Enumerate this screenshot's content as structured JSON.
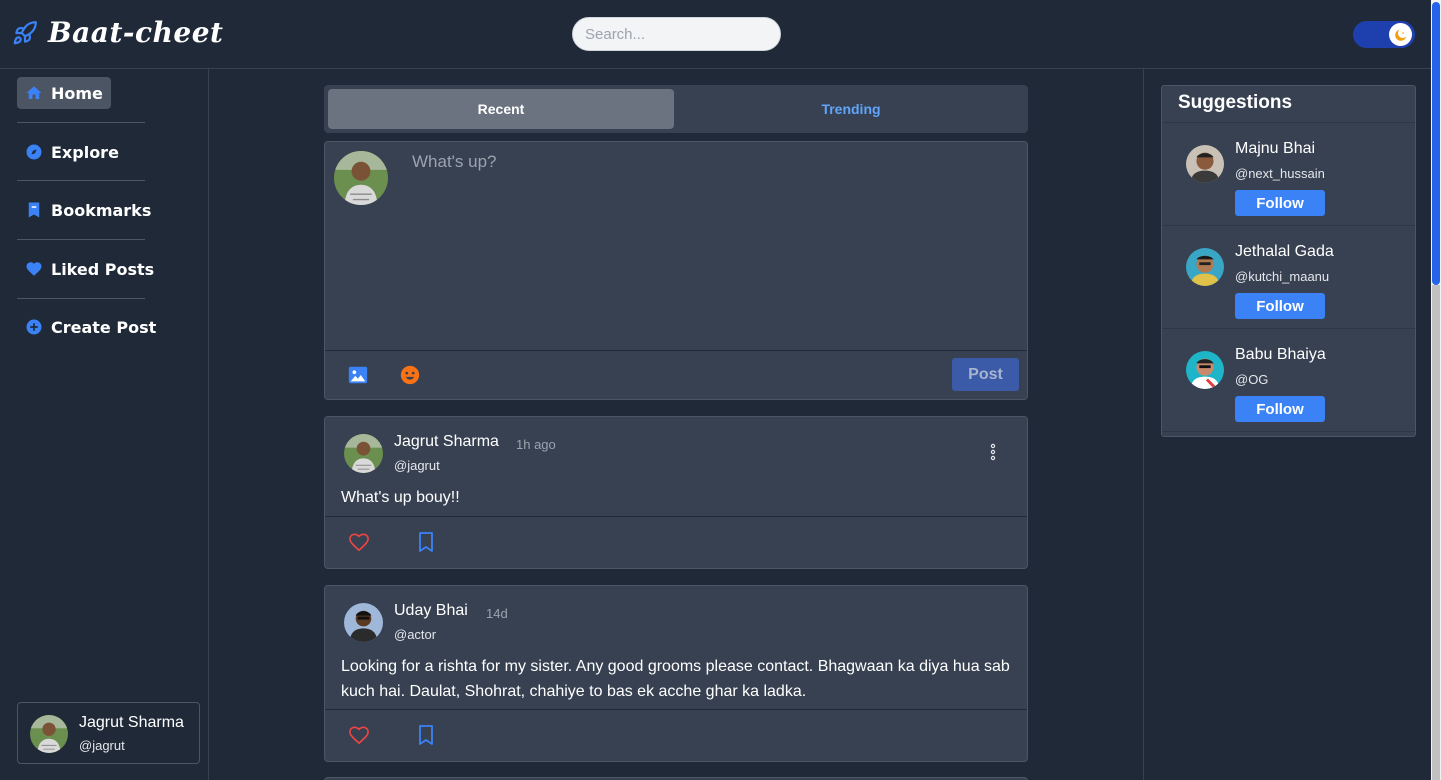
{
  "app": {
    "title": "Baat-cheet",
    "logo_icon": "rocket-icon"
  },
  "search": {
    "placeholder": "Search..."
  },
  "theme_toggle": {
    "icon": "moon-icon",
    "color": "#1e40af"
  },
  "sidebar": {
    "items": [
      {
        "label": "Home",
        "icon": "home-icon",
        "active": true
      },
      {
        "label": "Explore",
        "icon": "compass-icon"
      },
      {
        "label": "Bookmarks",
        "icon": "bookmark-icon"
      },
      {
        "label": "Liked Posts",
        "icon": "heart-icon"
      },
      {
        "label": "Create Post",
        "icon": "plus-circle-icon"
      }
    ],
    "profile": {
      "name": "Jagrut Sharma",
      "handle": "@jagrut"
    }
  },
  "feed": {
    "tabs": [
      {
        "label": "Recent",
        "active": true
      },
      {
        "label": "Trending"
      }
    ],
    "composer": {
      "placeholder": "What's up?",
      "post_label": "Post",
      "image_icon": "image-icon",
      "emoji_icon": "emoji-icon"
    },
    "posts": [
      {
        "author": "Jagrut Sharma",
        "time": "1h ago",
        "handle": "@jagrut",
        "body": "What's up bouy!!"
      },
      {
        "author": "Uday Bhai",
        "time": "14d",
        "handle": "@actor",
        "body": "Looking for a rishta for my sister. Any good grooms please contact. Bhagwaan ka diya hua sab kuch hai. Daulat, Shohrat, chahiye to bas ek acche ghar ka ladka."
      }
    ]
  },
  "suggestions": {
    "title": "Suggestions",
    "follow_label": "Follow",
    "people": [
      {
        "name": "Majnu Bhai",
        "handle": "@next_hussain"
      },
      {
        "name": "Jethalal Gada",
        "handle": "@kutchi_maanu"
      },
      {
        "name": "Babu Bhaiya",
        "handle": "@OG"
      }
    ]
  },
  "colors": {
    "background": "#1f2937",
    "card": "#374151",
    "accent": "#3b82f6",
    "like": "#ef4444",
    "emoji": "#f97316"
  }
}
